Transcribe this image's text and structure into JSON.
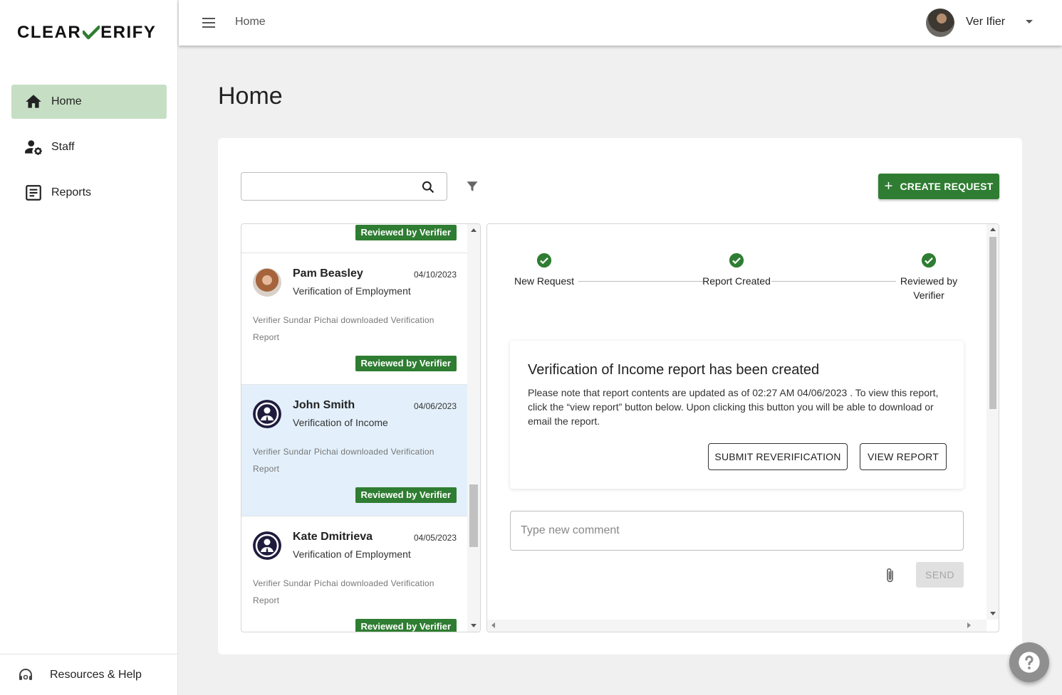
{
  "brand": {
    "logo_part1": "CLEAR",
    "logo_part2": "ERIFY",
    "check_color": "#2f7d32"
  },
  "sidebar": {
    "items": [
      {
        "label": "Home",
        "icon": "home-icon",
        "active": true
      },
      {
        "label": "Staff",
        "icon": "staff-settings-icon",
        "active": false
      },
      {
        "label": "Reports",
        "icon": "reports-icon",
        "active": false
      }
    ],
    "footer_label": "Resources & Help"
  },
  "topbar": {
    "breadcrumb": "Home",
    "user_name": "Ver Ifier"
  },
  "page": {
    "title": "Home"
  },
  "toolbar": {
    "search_placeholder": "",
    "create_label": "CREATE REQUEST",
    "create_plus": "+"
  },
  "requests": {
    "partial_badge": "Reviewed by Verifier",
    "items": [
      {
        "name": "Pam Beasley",
        "date": "04/10/2023",
        "type": "Verification of Employment",
        "note": "Verifier Sundar Pichai downloaded Verification Report",
        "badge": "Reviewed by Verifier",
        "selected": false
      },
      {
        "name": "John Smith",
        "date": "04/06/2023",
        "type": "Verification of Income",
        "note": "Verifier Sundar Pichai downloaded Verification Report",
        "badge": "Reviewed by Verifier",
        "selected": true
      },
      {
        "name": "Kate Dmitrieva",
        "date": "04/05/2023",
        "type": "Verification of Employment",
        "note": "Verifier Sundar Pichai downloaded Verification Report",
        "badge": "Reviewed by Verifier",
        "selected": false
      }
    ]
  },
  "detail": {
    "steps": [
      {
        "label": "New Request"
      },
      {
        "label": "Report Created"
      },
      {
        "label": "Reviewed by Verifier"
      }
    ],
    "report_title": "Verification of Income report has been created",
    "report_text": "Please note that report contents are updated as of 02:27 AM 04/06/2023 . To view this report, click the “view report” button below. Upon clicking this button you will be able to download or email the report.",
    "submit_reverification_label": "SUBMIT REVERIFICATION",
    "view_report_label": "VIEW REPORT",
    "comment_placeholder": "Type new comment",
    "send_label": "SEND"
  },
  "colors": {
    "accent": "#2f7d32",
    "active_nav": "#c6dfc4",
    "selected_row": "#e3f0fb"
  }
}
